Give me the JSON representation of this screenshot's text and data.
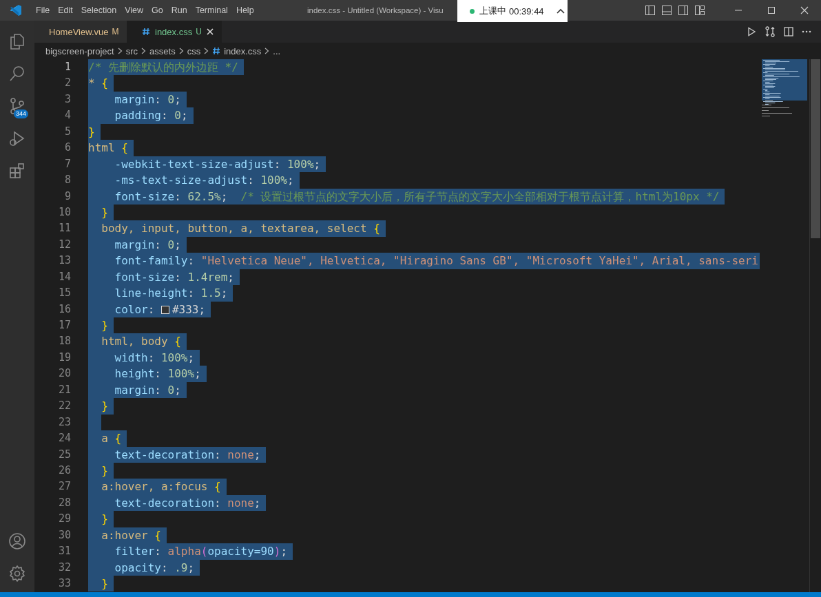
{
  "window": {
    "title": "index.css - Untitled (Workspace) - Visu"
  },
  "menu": [
    "File",
    "Edit",
    "Selection",
    "View",
    "Go",
    "Run",
    "Terminal",
    "Help"
  ],
  "recording": {
    "status": "上课中",
    "time": "00:39:44"
  },
  "activity_bar": {
    "source_control_badge": "344"
  },
  "tabs": [
    {
      "label": "HomeView.vue",
      "decoration": "M",
      "kind": "vue",
      "selected": false
    },
    {
      "label": "index.css",
      "decoration": "U",
      "kind": "css",
      "selected": true
    }
  ],
  "breadcrumb": [
    {
      "label": "bigscreen-project",
      "kind": "folder"
    },
    {
      "label": "src",
      "kind": "folder"
    },
    {
      "label": "assets",
      "kind": "folder"
    },
    {
      "label": "css",
      "kind": "folder"
    },
    {
      "label": "index.css",
      "kind": "css"
    },
    {
      "label": "...",
      "kind": "more"
    }
  ],
  "editor": {
    "lines": [
      {
        "number": "1",
        "kind": "top",
        "current": true,
        "selected": true,
        "tokens": [
          {
            "text": "/* 先删除默认的内外边距 */",
            "kind": "comment"
          }
        ]
      },
      {
        "number": "2",
        "kind": "top",
        "current": false,
        "selected": true,
        "tokens": [
          {
            "text": "*",
            "kind": "selector"
          },
          {
            "text": "{",
            "kind": "brace"
          }
        ]
      },
      {
        "number": "3",
        "kind": "decl",
        "current": false,
        "selected": true,
        "tokens": [
          {
            "text": "margin",
            "kind": "prop"
          },
          {
            "text": ":",
            "kind": "punct"
          },
          {
            "text": "0",
            "kind": "num"
          },
          {
            "text": ";",
            "kind": "punct"
          }
        ]
      },
      {
        "number": "4",
        "kind": "decl",
        "current": false,
        "selected": true,
        "tokens": [
          {
            "text": "padding",
            "kind": "prop"
          },
          {
            "text": ":",
            "kind": "punct"
          },
          {
            "text": "0",
            "kind": "num"
          },
          {
            "text": ";",
            "kind": "punct"
          }
        ]
      },
      {
        "number": "5",
        "kind": "top",
        "current": false,
        "selected": true,
        "tokens": [
          {
            "text": "}",
            "kind": "brace"
          }
        ]
      },
      {
        "number": "6",
        "kind": "top",
        "current": false,
        "selected": true,
        "tokens": [
          {
            "text": "html",
            "kind": "selector"
          },
          {
            "text": "{",
            "kind": "brace"
          }
        ]
      },
      {
        "number": "7",
        "kind": "decl",
        "current": false,
        "selected": true,
        "tokens": [
          {
            "text": "-webkit-text-size-adjust",
            "kind": "prop"
          },
          {
            "text": ":",
            "kind": "punct"
          },
          {
            "text": "100%",
            "kind": "num"
          },
          {
            "text": ";",
            "kind": "punct"
          }
        ]
      },
      {
        "number": "8",
        "kind": "decl",
        "current": false,
        "selected": true,
        "tokens": [
          {
            "text": "-ms-text-size-adjust",
            "kind": "prop"
          },
          {
            "text": ":",
            "kind": "punct"
          },
          {
            "text": "100%",
            "kind": "num"
          },
          {
            "text": ";",
            "kind": "punct"
          }
        ]
      },
      {
        "number": "9",
        "kind": "decl",
        "current": false,
        "selected": true,
        "tokens": [
          {
            "text": "font-size",
            "kind": "prop"
          },
          {
            "text": ":",
            "kind": "punct"
          },
          {
            "text": "62.5%",
            "kind": "num"
          },
          {
            "text": ";",
            "kind": "punct"
          },
          {
            "text": "/* 设置过根节点的文字大小后，所有子节点的文字大小全部相对于根节点计算，html为10px */",
            "kind": "comment"
          }
        ]
      },
      {
        "number": "10",
        "kind": "rule",
        "current": false,
        "selected": true,
        "tokens": [
          {
            "text": "}",
            "kind": "brace"
          }
        ]
      },
      {
        "number": "11",
        "kind": "rule",
        "current": false,
        "selected": true,
        "tokens": [
          {
            "text": "body, input, button, a, textarea, select",
            "kind": "selector"
          },
          {
            "text": "{",
            "kind": "brace"
          }
        ]
      },
      {
        "number": "12",
        "kind": "decl",
        "current": false,
        "selected": true,
        "tokens": [
          {
            "text": "margin",
            "kind": "prop"
          },
          {
            "text": ":",
            "kind": "punct"
          },
          {
            "text": "0",
            "kind": "num"
          },
          {
            "text": ";",
            "kind": "punct"
          }
        ]
      },
      {
        "number": "13",
        "kind": "decl",
        "current": false,
        "selected": true,
        "tokens": [
          {
            "text": "font-family",
            "kind": "prop"
          },
          {
            "text": ":",
            "kind": "punct"
          },
          {
            "text": "\"Helvetica Neue\", Helvetica, \"Hiragino Sans GB\", \"Microsoft YaHei\", Arial, sans-seri",
            "kind": "string"
          }
        ]
      },
      {
        "number": "14",
        "kind": "decl",
        "current": false,
        "selected": true,
        "tokens": [
          {
            "text": "font-size",
            "kind": "prop"
          },
          {
            "text": ":",
            "kind": "punct"
          },
          {
            "text": "1.4rem",
            "kind": "num"
          },
          {
            "text": ";",
            "kind": "punct"
          }
        ]
      },
      {
        "number": "15",
        "kind": "decl",
        "current": false,
        "selected": true,
        "tokens": [
          {
            "text": "line-height",
            "kind": "prop"
          },
          {
            "text": ":",
            "kind": "punct"
          },
          {
            "text": "1.5",
            "kind": "num"
          },
          {
            "text": ";",
            "kind": "punct"
          }
        ]
      },
      {
        "number": "16",
        "kind": "decl",
        "current": false,
        "selected": true,
        "tokens": [
          {
            "text": "color",
            "kind": "prop"
          },
          {
            "text": ":",
            "kind": "punct"
          },
          {
            "text": "#333",
            "kind": "color"
          },
          {
            "text": ";",
            "kind": "punct"
          }
        ]
      },
      {
        "number": "17",
        "kind": "rule",
        "current": false,
        "selected": true,
        "tokens": [
          {
            "text": "}",
            "kind": "brace"
          }
        ]
      },
      {
        "number": "18",
        "kind": "rule",
        "current": false,
        "selected": true,
        "tokens": [
          {
            "text": "html, body",
            "kind": "selector"
          },
          {
            "text": "{",
            "kind": "brace"
          }
        ]
      },
      {
        "number": "19",
        "kind": "decl",
        "current": false,
        "selected": true,
        "tokens": [
          {
            "text": "width",
            "kind": "prop"
          },
          {
            "text": ":",
            "kind": "punct"
          },
          {
            "text": "100%",
            "kind": "num"
          },
          {
            "text": ";",
            "kind": "punct"
          }
        ]
      },
      {
        "number": "20",
        "kind": "decl",
        "current": false,
        "selected": true,
        "tokens": [
          {
            "text": "height",
            "kind": "prop"
          },
          {
            "text": ":",
            "kind": "punct"
          },
          {
            "text": "100%",
            "kind": "num"
          },
          {
            "text": ";",
            "kind": "punct"
          }
        ]
      },
      {
        "number": "21",
        "kind": "decl",
        "current": false,
        "selected": true,
        "tokens": [
          {
            "text": "margin",
            "kind": "prop"
          },
          {
            "text": ":",
            "kind": "punct"
          },
          {
            "text": "0",
            "kind": "num"
          },
          {
            "text": ";",
            "kind": "punct"
          }
        ]
      },
      {
        "number": "22",
        "kind": "rule",
        "current": false,
        "selected": true,
        "tokens": [
          {
            "text": "}",
            "kind": "brace"
          }
        ]
      },
      {
        "number": "23",
        "kind": "rule",
        "current": false,
        "selected": true
      },
      {
        "number": "24",
        "kind": "rule",
        "current": false,
        "selected": true,
        "tokens": [
          {
            "text": "a",
            "kind": "selector"
          },
          {
            "text": "{",
            "kind": "brace"
          }
        ]
      },
      {
        "number": "25",
        "kind": "decl",
        "current": false,
        "selected": true,
        "tokens": [
          {
            "text": "text-decoration",
            "kind": "prop"
          },
          {
            "text": ":",
            "kind": "punct"
          },
          {
            "text": "none",
            "kind": "value"
          },
          {
            "text": ";",
            "kind": "punct"
          }
        ]
      },
      {
        "number": "26",
        "kind": "rule",
        "current": false,
        "selected": true,
        "tokens": [
          {
            "text": "}",
            "kind": "brace"
          }
        ]
      },
      {
        "number": "27",
        "kind": "rule",
        "current": false,
        "selected": true,
        "tokens": [
          {
            "text": "a:hover, a:focus",
            "kind": "selector"
          },
          {
            "text": "{",
            "kind": "brace"
          }
        ]
      },
      {
        "number": "28",
        "kind": "decl",
        "current": false,
        "selected": true,
        "tokens": [
          {
            "text": "text-decoration",
            "kind": "prop"
          },
          {
            "text": ":",
            "kind": "punct"
          },
          {
            "text": "none",
            "kind": "value"
          },
          {
            "text": ";",
            "kind": "punct"
          }
        ]
      },
      {
        "number": "29",
        "kind": "rule",
        "current": false,
        "selected": true,
        "tokens": [
          {
            "text": "}",
            "kind": "brace"
          }
        ]
      },
      {
        "number": "30",
        "kind": "rule",
        "current": false,
        "selected": true,
        "tokens": [
          {
            "text": "a:hover",
            "kind": "selector"
          },
          {
            "text": "{",
            "kind": "brace"
          }
        ]
      },
      {
        "number": "31",
        "kind": "decl",
        "current": false,
        "selected": true,
        "tokens": [
          {
            "text": "filter",
            "kind": "prop"
          },
          {
            "text": ":",
            "kind": "punct"
          },
          {
            "text": "alpha",
            "kind": "func"
          },
          {
            "text": "(",
            "kind": "paren"
          },
          {
            "text": "opacity=90",
            "kind": "prop"
          },
          {
            "text": ")",
            "kind": "paren"
          },
          {
            "text": ";",
            "kind": "punct"
          }
        ]
      },
      {
        "number": "32",
        "kind": "decl",
        "current": false,
        "selected": true,
        "tokens": [
          {
            "text": "opacity",
            "kind": "prop"
          },
          {
            "text": ":",
            "kind": "punct"
          },
          {
            "text": ".9",
            "kind": "num"
          },
          {
            "text": ";",
            "kind": "punct"
          }
        ]
      },
      {
        "number": "33",
        "kind": "rule",
        "current": false,
        "selected": true,
        "tokens": [
          {
            "text": "}",
            "kind": "brace"
          }
        ]
      }
    ]
  }
}
